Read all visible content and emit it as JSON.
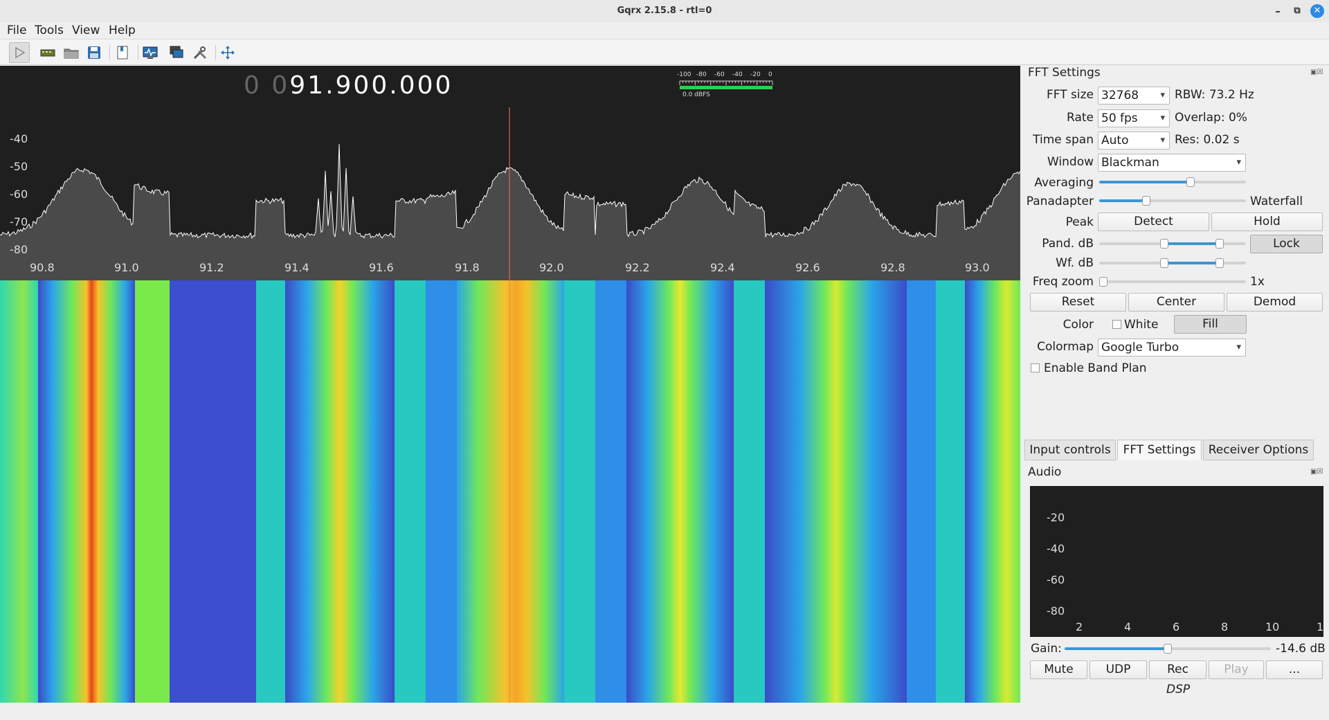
{
  "window": {
    "title": "Gqrx 2.15.8 - rtl=0"
  },
  "menu": [
    {
      "label": "File"
    },
    {
      "label": "Tools"
    },
    {
      "label": "View"
    },
    {
      "label": "Help"
    }
  ],
  "toolbar_icons": [
    "play-icon",
    "device-icon",
    "open-folder-icon",
    "save-icon",
    "bookmark-icon",
    "remote-control-icon",
    "screen-icon",
    "tools-icon",
    "resize-icon"
  ],
  "frequency": {
    "leading": "0 0",
    "value": "91.900.000"
  },
  "smeter": {
    "scale": [
      "-100",
      "-80",
      "-60",
      "-40",
      "-20",
      "0"
    ],
    "readout": "0.0 dBFS"
  },
  "panadapter": {
    "y_ticks": [
      "-40",
      "-50",
      "-60",
      "-70",
      "-80"
    ],
    "x_ticks": [
      "90.8",
      "91.0",
      "91.2",
      "91.4",
      "91.6",
      "91.8",
      "92.0",
      "92.2",
      "92.4",
      "92.6",
      "92.8",
      "93.0"
    ],
    "colors": {
      "background": "#1f1f1f",
      "fill": "#4a4a4a",
      "line": "#ffffff",
      "center_line": "#e3634b"
    }
  },
  "fft_settings": {
    "title": "FFT Settings",
    "fft_size_label": "FFT size",
    "fft_size_value": "32768",
    "rbw": "RBW: 73.2 Hz",
    "rate_label": "Rate",
    "rate_value": "50 fps",
    "overlap": "Overlap: 0%",
    "timespan_label": "Time span",
    "timespan_value": "Auto",
    "res": "Res: 0.02 s",
    "window_label": "Window",
    "window_value": "Blackman",
    "averaging_label": "Averaging",
    "averaging_level": 0.63,
    "panadapter_label": "Panadapter",
    "waterfall_label": "Waterfall",
    "split_level": 0.31,
    "peak_label": "Peak",
    "detect": "Detect",
    "hold": "Hold",
    "pand_db_label": "Pand. dB",
    "lock": "Lock",
    "wf_db_label": "Wf. dB",
    "freq_zoom_label": "Freq zoom",
    "freq_zoom_value": "1x",
    "reset": "Reset",
    "center": "Center",
    "demod": "Demod",
    "color_label": "Color",
    "white": "White",
    "fill": "Fill",
    "colormap_label": "Colormap",
    "colormap_value": "Google Turbo",
    "band_plan": "Enable Band Plan"
  },
  "tabs": [
    {
      "label": "Input controls"
    },
    {
      "label": "FFT Settings"
    },
    {
      "label": "Receiver Options"
    }
  ],
  "audio": {
    "title": "Audio",
    "y_ticks": [
      "-20",
      "-40",
      "-60",
      "-80"
    ],
    "x_ticks": [
      "2",
      "4",
      "6",
      "8",
      "10",
      "1"
    ],
    "gain_label": "Gain:",
    "gain_value": "-14.6 dB",
    "gain_level": 0.5,
    "mute": "Mute",
    "udp": "UDP",
    "rec": "Rec",
    "play": "Play",
    "more": "...",
    "dsp": "DSP"
  }
}
